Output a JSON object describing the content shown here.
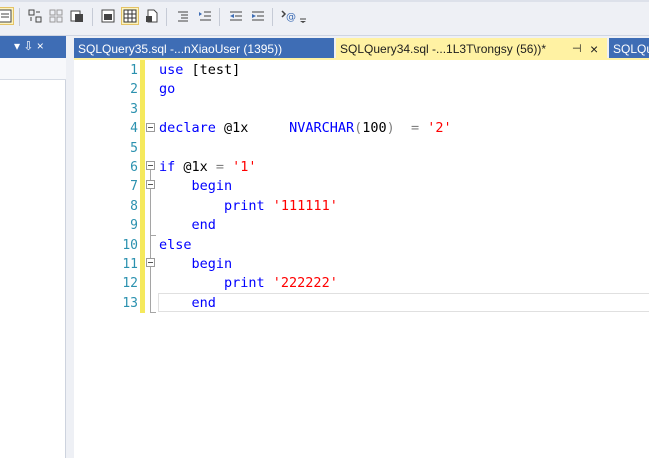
{
  "toolbar": {
    "icons": [
      "results-to-text-icon",
      "comment-icon",
      "uncomment-icon",
      "specify-values-icon",
      "results-to-grid-icon",
      "results-to-grid-active-icon",
      "results-to-file-icon",
      "format-icon",
      "outdent-icon",
      "decrease-indent-icon",
      "increase-indent-icon",
      "template-params-icon",
      "overflow-icon"
    ]
  },
  "left_panel": {
    "pin_glyph": "▾ ⇩ ×"
  },
  "tabs": [
    {
      "label": "SQLQuery35.sql -...nXiaoUser (1395))",
      "state": "inactive"
    },
    {
      "label": "SQLQuery34.sql -...1L3T\\rongsy (56))*",
      "state": "active",
      "pin": "⊣",
      "close": "×"
    },
    {
      "label": "SQLQu",
      "state": "inactive"
    }
  ],
  "editor": {
    "line_numbers": [
      "1",
      "2",
      "3",
      "4",
      "5",
      "6",
      "7",
      "8",
      "9",
      "10",
      "11",
      "12",
      "13"
    ],
    "lines": [
      [
        {
          "t": "use ",
          "c": "kw"
        },
        {
          "t": "[test]",
          "c": "plain"
        }
      ],
      [
        {
          "t": "go",
          "c": "kw"
        }
      ],
      [],
      [
        {
          "t": "declare ",
          "c": "kw"
        },
        {
          "t": "@1x     ",
          "c": "plain"
        },
        {
          "t": "NVARCHAR",
          "c": "kw"
        },
        {
          "t": "(",
          "c": "gr"
        },
        {
          "t": "100",
          "c": "plain"
        },
        {
          "t": ")  ",
          "c": "gr"
        },
        {
          "t": "= ",
          "c": "gr"
        },
        {
          "t": "'2'",
          "c": "str"
        }
      ],
      [],
      [
        {
          "t": "if ",
          "c": "kw"
        },
        {
          "t": "@1x ",
          "c": "plain"
        },
        {
          "t": "= ",
          "c": "gr"
        },
        {
          "t": "'1'",
          "c": "str"
        }
      ],
      [
        {
          "t": "    begin",
          "c": "kw"
        }
      ],
      [
        {
          "t": "        print ",
          "c": "kw"
        },
        {
          "t": "'111111'",
          "c": "str"
        }
      ],
      [
        {
          "t": "    end",
          "c": "kw"
        }
      ],
      [
        {
          "t": "else",
          "c": "kw"
        }
      ],
      [
        {
          "t": "    begin",
          "c": "kw"
        }
      ],
      [
        {
          "t": "        print ",
          "c": "kw"
        },
        {
          "t": "'222222'",
          "c": "str"
        }
      ],
      [
        {
          "t": "    end",
          "c": "kw"
        }
      ]
    ]
  },
  "colors": {
    "accent_tab": "#3e6db5",
    "active_tab": "#fff2a3",
    "keyword": "#0000ff",
    "string": "#ff0000",
    "operator": "#808080",
    "line_number": "#2b91af",
    "change_margin": "#f5e95c"
  }
}
